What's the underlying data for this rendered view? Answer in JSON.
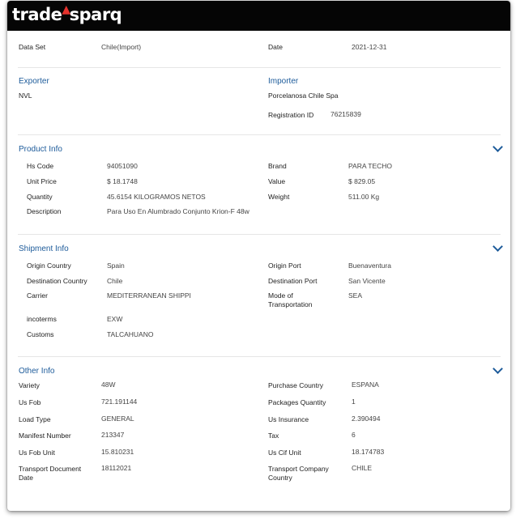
{
  "header": {
    "logo_left": "trade",
    "logo_right": "sparq"
  },
  "top": {
    "dataset_label": "Data Set",
    "dataset_value": "Chile(Import)",
    "date_label": "Date",
    "date_value": "2021-12-31"
  },
  "parties": {
    "exporter_title": "Exporter",
    "exporter_value": "NVL",
    "importer_title": "Importer",
    "importer_value": "Porcelanosa Chile Spa",
    "registration_label": "Registration ID",
    "registration_value": "76215839"
  },
  "product": {
    "title": "Product Info",
    "hs_label": "Hs Code",
    "hs_value": "94051090",
    "unit_price_label": "Unit Price",
    "unit_price_value": "$ 18.1748",
    "quantity_label": "Quantity",
    "quantity_value": "45.6154 KILOGRAMOS NETOS",
    "description_label": "Description",
    "description_value": "Para Uso En Alumbrado Conjunto Krion-F 48w",
    "brand_label": "Brand",
    "brand_value": "PARA TECHO",
    "value_label": "Value",
    "value_value": "$ 829.05",
    "weight_label": "Weight",
    "weight_value": "511.00 Kg"
  },
  "shipment": {
    "title": "Shipment Info",
    "origin_country_label": "Origin Country",
    "origin_country_value": "Spain",
    "destination_country_label": "Destination Country",
    "destination_country_value": "Chile",
    "carrier_label": "Carrier",
    "carrier_value": "MEDITERRANEAN SHIPPI",
    "incoterms_label": "incoterms",
    "incoterms_value": "EXW",
    "customs_label": "Customs",
    "customs_value": "TALCAHUANO",
    "origin_port_label": "Origin Port",
    "origin_port_value": "Buenaventura",
    "destination_port_label": "Destination Port",
    "destination_port_value": "San Vicente",
    "mode_label": "Mode of Transportation",
    "mode_value": "SEA"
  },
  "other": {
    "title": "Other Info",
    "variety_label": "Variety",
    "variety_value": "48W",
    "us_fob_label": "Us Fob",
    "us_fob_value": "721.191144",
    "load_type_label": "Load Type",
    "load_type_value": "GENERAL",
    "manifest_label": "Manifest Number",
    "manifest_value": "213347",
    "us_fob_unit_label": "Us Fob Unit",
    "us_fob_unit_value": "15.810231",
    "transport_doc_label": "Transport Document Date",
    "transport_doc_value": "18112021",
    "purchase_country_label": "Purchase Country",
    "purchase_country_value": "ESPANA",
    "packages_label": "Packages Quantity",
    "packages_value": "1",
    "us_insurance_label": "Us Insurance",
    "us_insurance_value": "2.390494",
    "tax_label": "Tax",
    "tax_value": "6",
    "us_cif_unit_label": "Us Cif Unit",
    "us_cif_unit_value": "18.174783",
    "transport_company_label": "Transport Company Country",
    "transport_company_value": "CHILE"
  },
  "colors": {
    "accent": "#1d5b9a",
    "topbar": "#050505",
    "logo_flame": "#e5322d"
  },
  "icons": {
    "section_toggle": "chevron-down-icon",
    "logo_mark": "flame-icon"
  }
}
